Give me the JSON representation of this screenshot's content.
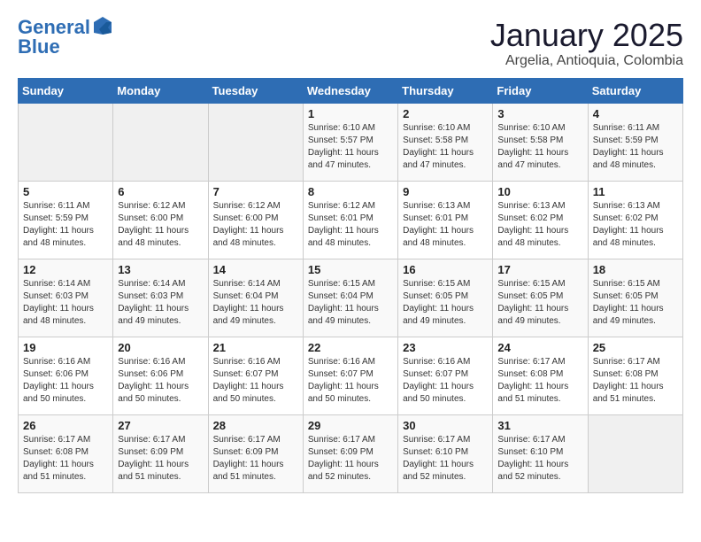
{
  "logo": {
    "line1": "General",
    "line2": "Blue"
  },
  "title": "January 2025",
  "subtitle": "Argelia, Antioquia, Colombia",
  "weekdays": [
    "Sunday",
    "Monday",
    "Tuesday",
    "Wednesday",
    "Thursday",
    "Friday",
    "Saturday"
  ],
  "weeks": [
    [
      {
        "day": "",
        "info": ""
      },
      {
        "day": "",
        "info": ""
      },
      {
        "day": "",
        "info": ""
      },
      {
        "day": "1",
        "info": "Sunrise: 6:10 AM\nSunset: 5:57 PM\nDaylight: 11 hours\nand 47 minutes."
      },
      {
        "day": "2",
        "info": "Sunrise: 6:10 AM\nSunset: 5:58 PM\nDaylight: 11 hours\nand 47 minutes."
      },
      {
        "day": "3",
        "info": "Sunrise: 6:10 AM\nSunset: 5:58 PM\nDaylight: 11 hours\nand 47 minutes."
      },
      {
        "day": "4",
        "info": "Sunrise: 6:11 AM\nSunset: 5:59 PM\nDaylight: 11 hours\nand 48 minutes."
      }
    ],
    [
      {
        "day": "5",
        "info": "Sunrise: 6:11 AM\nSunset: 5:59 PM\nDaylight: 11 hours\nand 48 minutes."
      },
      {
        "day": "6",
        "info": "Sunrise: 6:12 AM\nSunset: 6:00 PM\nDaylight: 11 hours\nand 48 minutes."
      },
      {
        "day": "7",
        "info": "Sunrise: 6:12 AM\nSunset: 6:00 PM\nDaylight: 11 hours\nand 48 minutes."
      },
      {
        "day": "8",
        "info": "Sunrise: 6:12 AM\nSunset: 6:01 PM\nDaylight: 11 hours\nand 48 minutes."
      },
      {
        "day": "9",
        "info": "Sunrise: 6:13 AM\nSunset: 6:01 PM\nDaylight: 11 hours\nand 48 minutes."
      },
      {
        "day": "10",
        "info": "Sunrise: 6:13 AM\nSunset: 6:02 PM\nDaylight: 11 hours\nand 48 minutes."
      },
      {
        "day": "11",
        "info": "Sunrise: 6:13 AM\nSunset: 6:02 PM\nDaylight: 11 hours\nand 48 minutes."
      }
    ],
    [
      {
        "day": "12",
        "info": "Sunrise: 6:14 AM\nSunset: 6:03 PM\nDaylight: 11 hours\nand 48 minutes."
      },
      {
        "day": "13",
        "info": "Sunrise: 6:14 AM\nSunset: 6:03 PM\nDaylight: 11 hours\nand 49 minutes."
      },
      {
        "day": "14",
        "info": "Sunrise: 6:14 AM\nSunset: 6:04 PM\nDaylight: 11 hours\nand 49 minutes."
      },
      {
        "day": "15",
        "info": "Sunrise: 6:15 AM\nSunset: 6:04 PM\nDaylight: 11 hours\nand 49 minutes."
      },
      {
        "day": "16",
        "info": "Sunrise: 6:15 AM\nSunset: 6:05 PM\nDaylight: 11 hours\nand 49 minutes."
      },
      {
        "day": "17",
        "info": "Sunrise: 6:15 AM\nSunset: 6:05 PM\nDaylight: 11 hours\nand 49 minutes."
      },
      {
        "day": "18",
        "info": "Sunrise: 6:15 AM\nSunset: 6:05 PM\nDaylight: 11 hours\nand 49 minutes."
      }
    ],
    [
      {
        "day": "19",
        "info": "Sunrise: 6:16 AM\nSunset: 6:06 PM\nDaylight: 11 hours\nand 50 minutes."
      },
      {
        "day": "20",
        "info": "Sunrise: 6:16 AM\nSunset: 6:06 PM\nDaylight: 11 hours\nand 50 minutes."
      },
      {
        "day": "21",
        "info": "Sunrise: 6:16 AM\nSunset: 6:07 PM\nDaylight: 11 hours\nand 50 minutes."
      },
      {
        "day": "22",
        "info": "Sunrise: 6:16 AM\nSunset: 6:07 PM\nDaylight: 11 hours\nand 50 minutes."
      },
      {
        "day": "23",
        "info": "Sunrise: 6:16 AM\nSunset: 6:07 PM\nDaylight: 11 hours\nand 50 minutes."
      },
      {
        "day": "24",
        "info": "Sunrise: 6:17 AM\nSunset: 6:08 PM\nDaylight: 11 hours\nand 51 minutes."
      },
      {
        "day": "25",
        "info": "Sunrise: 6:17 AM\nSunset: 6:08 PM\nDaylight: 11 hours\nand 51 minutes."
      }
    ],
    [
      {
        "day": "26",
        "info": "Sunrise: 6:17 AM\nSunset: 6:08 PM\nDaylight: 11 hours\nand 51 minutes."
      },
      {
        "day": "27",
        "info": "Sunrise: 6:17 AM\nSunset: 6:09 PM\nDaylight: 11 hours\nand 51 minutes."
      },
      {
        "day": "28",
        "info": "Sunrise: 6:17 AM\nSunset: 6:09 PM\nDaylight: 11 hours\nand 51 minutes."
      },
      {
        "day": "29",
        "info": "Sunrise: 6:17 AM\nSunset: 6:09 PM\nDaylight: 11 hours\nand 52 minutes."
      },
      {
        "day": "30",
        "info": "Sunrise: 6:17 AM\nSunset: 6:10 PM\nDaylight: 11 hours\nand 52 minutes."
      },
      {
        "day": "31",
        "info": "Sunrise: 6:17 AM\nSunset: 6:10 PM\nDaylight: 11 hours\nand 52 minutes."
      },
      {
        "day": "",
        "info": ""
      }
    ]
  ]
}
